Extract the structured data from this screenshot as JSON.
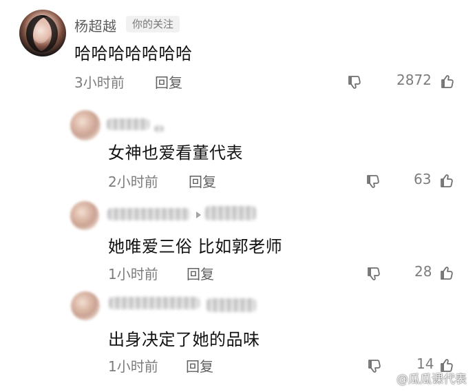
{
  "comments": [
    {
      "username": "杨超越",
      "follow_badge": "你的关注",
      "text": "哈哈哈哈哈哈哈",
      "time": "3小时前",
      "reply": "回复",
      "likes": "2872"
    },
    {
      "text": "女神也爱看董代表",
      "time": "2小时前",
      "reply": "回复",
      "likes": "63"
    },
    {
      "text": "她唯爱三俗 比如郭老师",
      "time": "1小时前",
      "reply": "回复",
      "likes": "28"
    },
    {
      "text": "出身决定了她的品味",
      "time": "1小时前",
      "reply": "回复",
      "likes": "14"
    }
  ],
  "watermark": {
    "text": "@瓜瓜课代表"
  },
  "icons": {
    "dislike": "thumbs-down-icon",
    "like": "thumbs-up-icon",
    "watermark": "weibo-logo-icon",
    "separator": "caret-right-icon"
  },
  "colors": {
    "background": "#ffffff",
    "text_primary": "#111111",
    "text_secondary": "#7c7c7c",
    "badge_bg": "#f1f1f1"
  }
}
